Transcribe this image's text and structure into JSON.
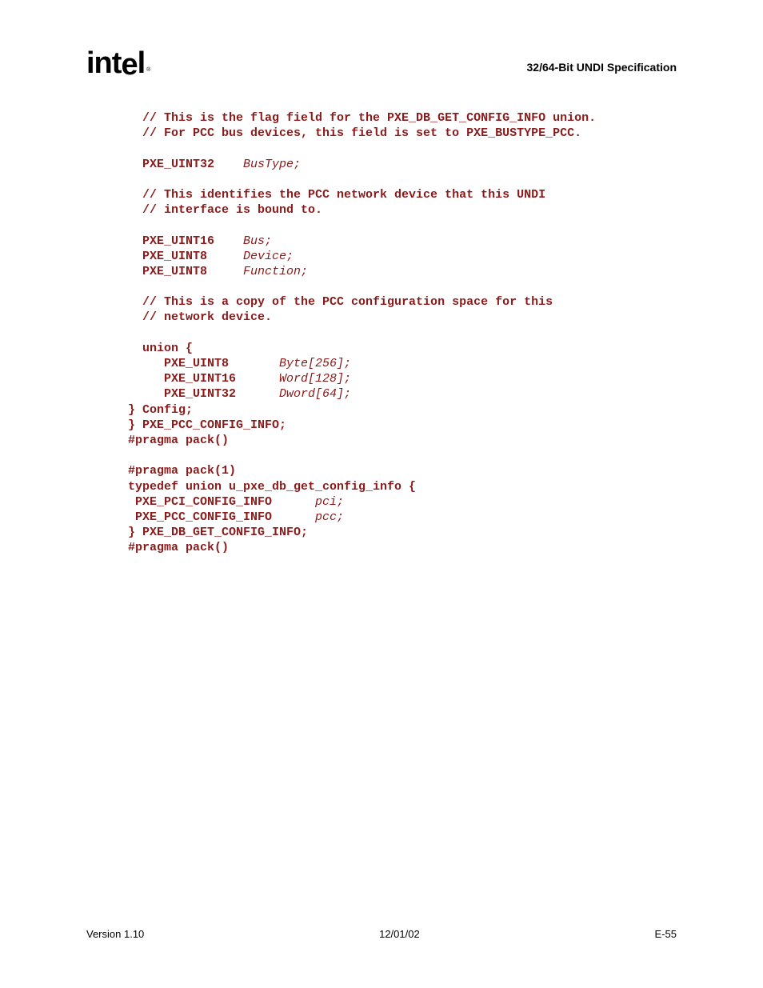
{
  "header": {
    "logo": "intel",
    "spec_title": "32/64-Bit UNDI Specification"
  },
  "code": {
    "c1": "  // This is the flag field for the PXE_DB_GET_CONFIG_INFO union.",
    "c2": "  // For PCC bus devices, this field is set to PXE_BUSTYPE_PCC.",
    "l1a": "  PXE_UINT32    ",
    "l1b": "BusType;",
    "c3": "  // This identifies the PCC network device that this UNDI",
    "c4": "  // interface is bound to.",
    "l2a": "  PXE_UINT16    ",
    "l2b": "Bus;",
    "l3a": "  PXE_UINT8     ",
    "l3b": "Device;",
    "l4a": "  PXE_UINT8     ",
    "l4b": "Function;",
    "c5": "  // This is a copy of the PCC configuration space for this",
    "c6": "  // network device.",
    "l5": "  union {",
    "l6a": "     PXE_UINT8       ",
    "l6b": "Byte[256];",
    "l7a": "     PXE_UINT16      ",
    "l7b": "Word[128];",
    "l8a": "     PXE_UINT32      ",
    "l8b": "Dword[64];",
    "l9": "} Config;",
    "l10": "} PXE_PCC_CONFIG_INFO;",
    "l11": "#pragma pack()",
    "l12": "#pragma pack(1)",
    "l13": "typedef union u_pxe_db_get_config_info {",
    "l14a": " PXE_PCI_CONFIG_INFO      ",
    "l14b": "pci;",
    "l15a": " PXE_PCC_CONFIG_INFO      ",
    "l15b": "pcc;",
    "l16": "} PXE_DB_GET_CONFIG_INFO;",
    "l17": "#pragma pack()"
  },
  "footer": {
    "version": "Version 1.10",
    "date": "12/01/02",
    "page": "E-55"
  }
}
